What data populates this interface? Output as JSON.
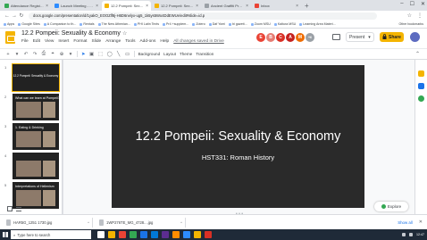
{
  "browser": {
    "tabs": [
      {
        "label": "Attendance Register - GLBS HC",
        "favicon_color": "#34a853",
        "active": false
      },
      {
        "label": "Launch Meeting - Zoom",
        "favicon_color": "#2d8cff",
        "active": false
      },
      {
        "label": "12.2 Pompeii: Sexuality & Econ",
        "favicon_color": "#f4b400",
        "active": true
      },
      {
        "label": "12.2 Pompeii: Sexuality & Eco",
        "favicon_color": "#f4b400",
        "active": false
      },
      {
        "label": "Ancient Graffiti Project : Search",
        "favicon_color": "#9aa0a6",
        "active": false
      },
      {
        "label": "Inbox",
        "favicon_color": "#ea4335",
        "active": false
      }
    ],
    "new_tab": "+",
    "window_controls": [
      "–",
      "☐",
      "✕"
    ],
    "url": "docs.google.com/presentation/d/1yakO_EOOZlf8j-H6D6nelyx-ug5_1k5ys5Wo4DdEWUe/edit#slide=id.p",
    "nav": [
      "←",
      "→",
      "↻"
    ],
    "toolbar_icons": [
      "☆",
      "⋮"
    ],
    "bookmarks": [
      "Apps",
      "Google Sites",
      "A Companion to th...",
      "Rentals",
      "The New Athenian...",
      "PHI Latin Texts",
      "Pr4 +supplem...",
      "Zotero",
      "Daf Yomi",
      "bi gazett...",
      "Zoom MSU",
      "Kaltura MSU",
      "Learning Area Materi..."
    ],
    "other_bookmarks": "Other bookmarks"
  },
  "doc": {
    "title": "12.2 Pompeii: Sexuality & Economy",
    "star": "☆",
    "menu": [
      "File",
      "Edit",
      "View",
      "Insert",
      "Format",
      "Slide",
      "Arrange",
      "Tools",
      "Add-ons",
      "Help"
    ],
    "saved_status": "All changes saved in Drive",
    "collaborators": [
      {
        "letter": "E",
        "color": "#ea4335"
      },
      {
        "letter": "B",
        "color": "#e67c73"
      },
      {
        "letter": "C",
        "color": "#d93025"
      },
      {
        "letter": "A",
        "color": "#c5221f"
      },
      {
        "letter": "M",
        "color": "#ef6c00"
      },
      {
        "letter": "+6",
        "color": "#9aa0a6"
      }
    ],
    "present_label": "Present",
    "present_caret": "▾",
    "share_label": "Share",
    "share_icon": "lock-icon"
  },
  "toolbar": {
    "icons": [
      "+",
      "▾",
      "↶",
      "↷",
      "⎙",
      "⌖",
      "⊕",
      "▾"
    ],
    "tools": [
      "▣",
      "⬚",
      "◯",
      "╲",
      "▭"
    ],
    "background_label": "Background",
    "layout_label": "Layout",
    "theme_label": "Theme",
    "transition_label": "Transition",
    "collapse": "⌃"
  },
  "filmstrip": {
    "slides": [
      {
        "num": "1",
        "title": "12.2 Pompeii: Sexuality & Economy",
        "style": "title",
        "selected": true
      },
      {
        "num": "2",
        "title": "What can we learn at Pompeii?",
        "style": "image",
        "selected": false
      },
      {
        "num": "3",
        "title": "1. Eating & Drinking",
        "style": "image",
        "selected": false
      },
      {
        "num": "4",
        "title": "",
        "style": "image",
        "selected": false
      },
      {
        "num": "5",
        "title": "Interpretations of Hellenism",
        "style": "image",
        "selected": false
      }
    ]
  },
  "slide": {
    "title": "12.2 Pompeii: Sexuality & Economy",
    "subtitle": "HST331: Roman History",
    "background": "#2a2a2a"
  },
  "explore_label": "Explore",
  "side_panel_colors": [
    "#f4b400",
    "#1a73e8",
    "#34a853"
  ],
  "downloads": {
    "items": [
      {
        "name": "HAR5G_1251 1730.jpg"
      },
      {
        "name": "1WP276TE_MG_4728....jpg"
      }
    ],
    "show_all": "Show all",
    "close": "✕"
  },
  "taskbar": {
    "search_placeholder": "Type here to search",
    "apps": [
      "#ffffff",
      "#f4b400",
      "#ea4335",
      "#34a853",
      "#1a73e8",
      "#0078d7",
      "#5c2d91",
      "#ff8c00",
      "#2d8cff",
      "#f4b400",
      "#d93025"
    ],
    "tray_text": "12:47"
  }
}
